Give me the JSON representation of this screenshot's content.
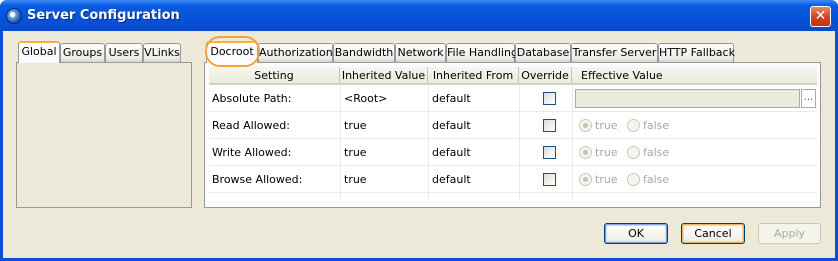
{
  "window": {
    "title": "Server Configuration",
    "close_glyph": "✕"
  },
  "left_tabs": [
    {
      "label": "Global",
      "active": true
    },
    {
      "label": "Groups",
      "active": false
    },
    {
      "label": "Users",
      "active": false
    },
    {
      "label": "VLinks",
      "active": false
    }
  ],
  "right_tabs": [
    {
      "label": "Docroot",
      "active": true
    },
    {
      "label": "Authorization",
      "active": false
    },
    {
      "label": "Bandwidth",
      "active": false
    },
    {
      "label": "Network",
      "active": false
    },
    {
      "label": "File Handling",
      "active": false
    },
    {
      "label": "Database",
      "active": false
    },
    {
      "label": "Transfer Server",
      "active": false
    },
    {
      "label": "HTTP Fallback",
      "active": false
    }
  ],
  "grid": {
    "headers": [
      "Setting",
      "Inherited Value",
      "Inherited From",
      "Override",
      "Effective Value"
    ],
    "rows": [
      {
        "setting": "Absolute Path:",
        "inherited_value": "<Root>",
        "inherited_from": "default",
        "override": false,
        "effective": {
          "kind": "path",
          "value": "",
          "browse_label": "..."
        }
      },
      {
        "setting": "Read Allowed:",
        "inherited_value": "true",
        "inherited_from": "default",
        "override": false,
        "effective": {
          "kind": "bool",
          "true_label": "true",
          "false_label": "false",
          "selected": "true"
        }
      },
      {
        "setting": "Write Allowed:",
        "inherited_value": "true",
        "inherited_from": "default",
        "override": false,
        "effective": {
          "kind": "bool",
          "true_label": "true",
          "false_label": "false",
          "selected": "true"
        }
      },
      {
        "setting": "Browse Allowed:",
        "inherited_value": "true",
        "inherited_from": "default",
        "override": false,
        "effective": {
          "kind": "bool",
          "true_label": "true",
          "false_label": "false",
          "selected": "true"
        }
      }
    ]
  },
  "buttons": {
    "ok": "OK",
    "cancel": "Cancel",
    "apply": "Apply"
  },
  "colors": {
    "titlebar": "#0553d8",
    "dialog_bg": "#ece9d8",
    "focus_ring": "#f5a23a",
    "close_button": "#d2411c"
  }
}
